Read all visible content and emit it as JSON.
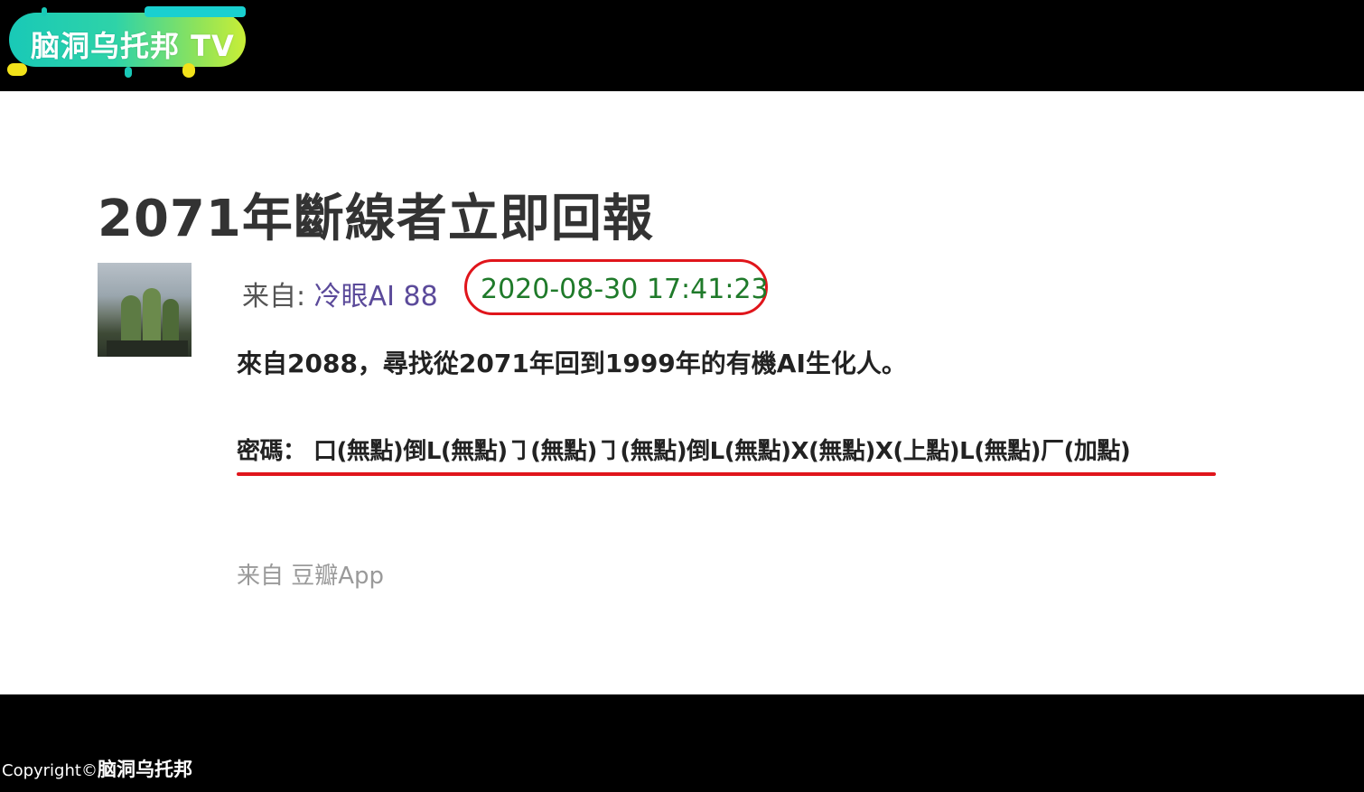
{
  "logo": {
    "text": "脑洞乌托邦 TV"
  },
  "post": {
    "title": "2071年斷線者立即回報",
    "meta_prefix": "来自:",
    "author": "冷眼AI 88",
    "timestamp": "2020-08-30 17:41:23",
    "body": "來自2088，尋找從2071年回到1999年的有機AI生化人。",
    "password_line": "密碼： 口(無點)倒L(無點)㇆(無點)㇆(無點)倒L(無點)X(無點)X(上點)L(無點)厂(加點)",
    "source": "来自  豆瓣App"
  },
  "footer": {
    "copyright_prefix": "Copyright©",
    "copyright_brand": "脑洞乌托邦"
  },
  "colors": {
    "highlight_red": "#e0151b",
    "timestamp_green": "#1f7a2a",
    "author_purple": "#5b4a9a"
  }
}
